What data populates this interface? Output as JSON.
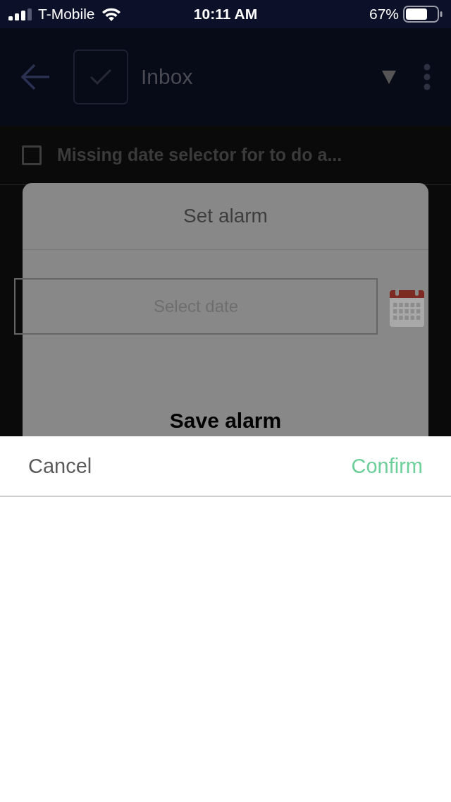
{
  "status_bar": {
    "carrier": "T-Mobile",
    "time": "10:11 AM",
    "battery": "67%"
  },
  "app_bar": {
    "title": "Inbox"
  },
  "task": {
    "title": "Missing date selector for to do a...",
    "checked": false
  },
  "dialog": {
    "title": "Set alarm",
    "date_field": {
      "placeholder": "Select date"
    },
    "save_button": "Save alarm"
  },
  "sheet": {
    "cancel": "Cancel",
    "confirm": "Confirm"
  }
}
